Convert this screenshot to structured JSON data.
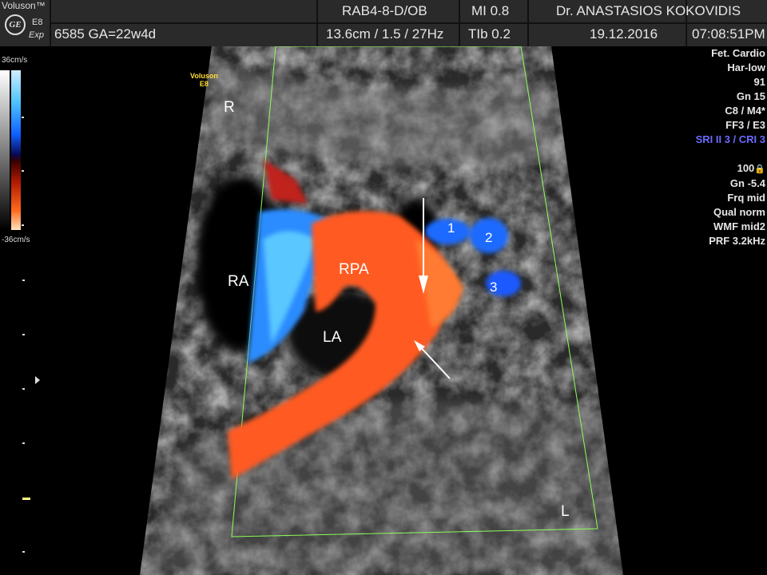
{
  "header": {
    "brand": "Voluson™",
    "logo_text": "GE",
    "model": "E8",
    "probe_mode": "Exp",
    "patient_id_ga": "6585 GA=22w4d",
    "probe_preset": "RAB4-8-D/OB",
    "depth_freq": "13.6cm / 1.5 / 27Hz",
    "mi": "MI  0.8",
    "tib": "TIb  0.2",
    "operator": "Dr. ANASTASIOS KOKOVIDIS",
    "date": "19.12.2016",
    "time": "07:08:51PM"
  },
  "color_scale": {
    "top_label": "36cm/s",
    "bottom_label": "-36cm/s"
  },
  "params": {
    "app": "Fet. Cardio",
    "harmonic": "Har-low",
    "value_91": "91",
    "gain": "Gn  15",
    "map": "C8 / M4*",
    "filter": "FF3 / E3",
    "sri_cri": "SRI II 3 / CRI 3",
    "power": "100",
    "color_gain": "Gn -5.4",
    "freq": "Frq mid",
    "quality": "Qual norm",
    "wmf": "WMF mid2",
    "prf": "PRF  3.2kHz"
  },
  "image_labels": {
    "watermark_line1": "Voluson",
    "watermark_line2": "E8",
    "right_orient": "R",
    "left_orient": "L",
    "ra": "RA",
    "la": "LA",
    "rpa": "RPA",
    "vessel_1": "1",
    "vessel_2": "2",
    "vessel_3": "3"
  },
  "colors": {
    "header_bg": "#2a2a2a",
    "sector_outline": "#8cff5a",
    "flow_red": "#ff5a20",
    "flow_blue": "#2a8cff",
    "accent_text": "#6a6aff"
  }
}
